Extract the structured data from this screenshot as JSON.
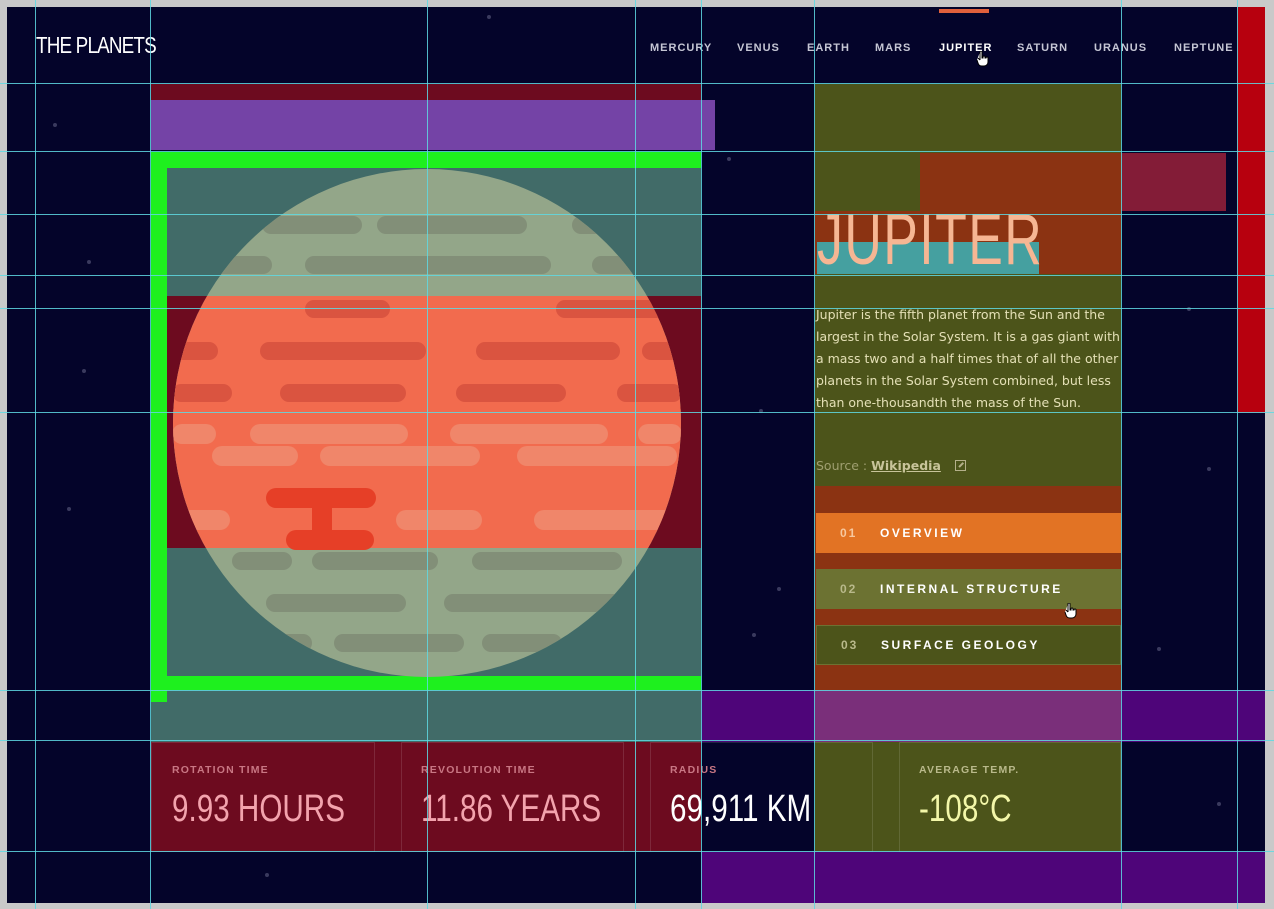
{
  "logo": "THE PLANETS",
  "nav": [
    {
      "label": "MERCURY"
    },
    {
      "label": "VENUS"
    },
    {
      "label": "EARTH"
    },
    {
      "label": "MARS"
    },
    {
      "label": "JUPITER"
    },
    {
      "label": "SATURN"
    },
    {
      "label": "URANUS"
    },
    {
      "label": "NEPTUNE"
    }
  ],
  "active_planet": "JUPITER",
  "planet": {
    "name": "JUPITER",
    "description": "Jupiter is the fifth planet from the Sun and the largest in the Solar System. It is a gas giant with a mass two and a half times that of all the other planets in the Solar System combined, but less than one-thousandth the mass of the Sun.",
    "source_label": "Source :",
    "source_link": "Wikipedia",
    "image_icon": "jupiter-planet-illustration"
  },
  "tabs": [
    {
      "num": "01",
      "label": "OVERVIEW",
      "active": true
    },
    {
      "num": "02",
      "label": "INTERNAL STRUCTURE",
      "active": false
    },
    {
      "num": "03",
      "label": "SURFACE GEOLOGY",
      "active": false
    }
  ],
  "stats": [
    {
      "label": "ROTATION TIME",
      "value": "9.93 HOURS"
    },
    {
      "label": "REVOLUTION TIME",
      "value": "11.86 YEARS"
    },
    {
      "label": "RADIUS",
      "value": "69,911 KM"
    },
    {
      "label": "AVERAGE TEMP.",
      "value": "-108°C"
    }
  ],
  "colors": {
    "background": "#04042a",
    "accent_jupiter": "#e27324",
    "nav_indicator": "#e0603c",
    "grid_guide": "#5fd9e3"
  },
  "icons": {
    "external_link": "external-link-icon",
    "cursor": "pointer-hand-icon"
  }
}
